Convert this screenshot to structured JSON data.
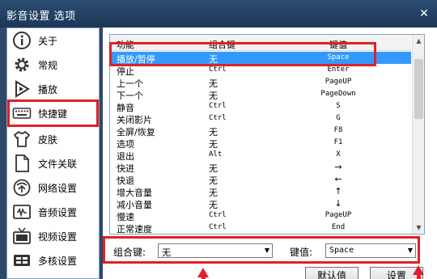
{
  "window": {
    "title": "影音设置 选项",
    "close_glyph": "✕"
  },
  "sidebar": {
    "items": [
      {
        "label": "关于",
        "icon": "info-icon"
      },
      {
        "label": "常规",
        "icon": "gear-icon"
      },
      {
        "label": "播放",
        "icon": "play-icon"
      },
      {
        "label": "快捷键",
        "icon": "keyboard-icon",
        "selected": true
      },
      {
        "label": "皮肤",
        "icon": "shirt-icon"
      },
      {
        "label": "文件关联",
        "icon": "file-icon"
      },
      {
        "label": "网络设置",
        "icon": "network-icon"
      },
      {
        "label": "音频设置",
        "icon": "audio-icon"
      },
      {
        "label": "视频设置",
        "icon": "tv-icon"
      },
      {
        "label": "多核设置",
        "icon": "multicore-icon"
      }
    ]
  },
  "hotkeys": {
    "columns": [
      "功能",
      "组合键",
      "键值"
    ],
    "rows": [
      {
        "func": "播放/暂停",
        "mod": "无",
        "key": "Space",
        "selected": true
      },
      {
        "func": "停止",
        "mod": "Ctrl",
        "key": "Enter"
      },
      {
        "func": "上一个",
        "mod": "无",
        "key": "PageUP"
      },
      {
        "func": "下一个",
        "mod": "无",
        "key": "PageDown"
      },
      {
        "func": "静音",
        "mod": "Ctrl",
        "key": "S"
      },
      {
        "func": "关闭影片",
        "mod": "Ctrl",
        "key": "G"
      },
      {
        "func": "全屏/恢复",
        "mod": "无",
        "key": "F8"
      },
      {
        "func": "选项",
        "mod": "无",
        "key": "F1"
      },
      {
        "func": "退出",
        "mod": "Alt",
        "key": "X"
      },
      {
        "func": "快进",
        "mod": "无",
        "key": "→"
      },
      {
        "func": "快退",
        "mod": "无",
        "key": "←"
      },
      {
        "func": "增大音量",
        "mod": "无",
        "key": "↑"
      },
      {
        "func": "减小音量",
        "mod": "无",
        "key": "↓"
      },
      {
        "func": "慢速",
        "mod": "Ctrl",
        "key": "PageUP"
      },
      {
        "func": "正常速度",
        "mod": "Ctrl",
        "key": "End"
      }
    ]
  },
  "editor": {
    "mod_label": "组合键:",
    "mod_value": "无",
    "key_label": "键值:",
    "key_value": "Space"
  },
  "buttons": {
    "default": "默认值",
    "set": "设置"
  },
  "colors": {
    "accent_red": "#e0202a",
    "selection_blue": "#3399ff",
    "titlebar": "#1c3656"
  }
}
